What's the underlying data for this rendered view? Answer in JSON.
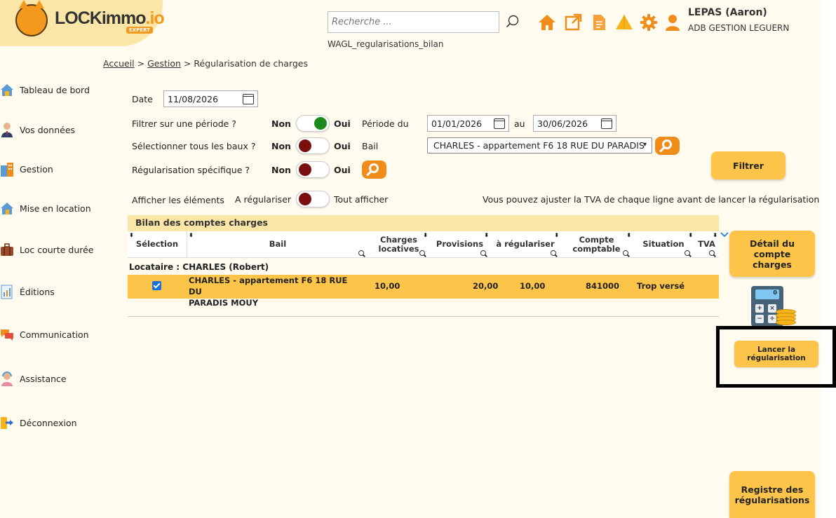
{
  "header": {
    "logo_text": "LOCKimmo",
    "logo_suffix": ".io",
    "logo_badge": "EXPERT",
    "search_placeholder": "Recherche ...",
    "page_code": "WAGL_regularisations_bilan",
    "user_name": "LEPAS (Aaron)",
    "user_org": "ADB GESTION LEGUERN",
    "icons": [
      "home-icon",
      "external-link-icon",
      "document-icon",
      "alert-triangle-icon",
      "gear-icon",
      "user-icon"
    ],
    "accent": "#f08c1a"
  },
  "breadcrumb": {
    "home": "Accueil",
    "sep1": ">",
    "section": "Gestion",
    "sep2": ">",
    "current": "Régularisation de charges"
  },
  "sidebar": {
    "items": [
      {
        "label": "Tableau de bord",
        "icon": "dashboard-house-icon"
      },
      {
        "label": "Vos données",
        "icon": "person-icon"
      },
      {
        "label": "Gestion",
        "icon": "buildings-icon"
      },
      {
        "label": "Mise en location",
        "icon": "house-rent-icon"
      },
      {
        "label": "Loc courte durée",
        "icon": "suitcase-icon"
      },
      {
        "label": "Éditions",
        "icon": "report-icon"
      },
      {
        "label": "Communication",
        "icon": "chat-bubbles-icon"
      },
      {
        "label": "Assistance",
        "icon": "support-agent-icon"
      },
      {
        "label": "Déconnexion",
        "icon": "logout-icon"
      }
    ]
  },
  "form": {
    "date_label": "Date",
    "date_value": "11/08/2026",
    "periode_filter_label": "Filtrer sur une période ?",
    "tous_baux_label": "Sélectionner tous les baux ?",
    "specifique_label": "Régularisation spécifique ?",
    "non": "Non",
    "oui": "Oui",
    "periode_du_label": "Période du",
    "periode_du": "01/01/2026",
    "au_label": "au",
    "periode_au": "30/06/2026",
    "bail_label": "Bail",
    "bail_value": "CHARLES - appartement F6 18 RUE DU PARADIS",
    "afficher_label": "Afficher les éléments",
    "a_regulariser": "A régulariser",
    "tout_afficher": "Tout afficher",
    "tva_note": "Vous pouvez ajuster la TVA de chaque ligne avant de lancer la régularisation",
    "toggles": {
      "periode": "on",
      "tous_baux": "off",
      "specifique": "off",
      "afficher": "off"
    }
  },
  "buttons": {
    "filtrer": "Filtrer",
    "detail_l1": "Détail du",
    "detail_l2": "compte",
    "detail_l3": "charges",
    "lancer_l1": "Lancer la",
    "lancer_l2": "régularisation",
    "registre_l1": "Registre des",
    "registre_l2": "régularisations"
  },
  "table": {
    "title": "Bilan des comptes charges",
    "columns": {
      "selection": "Sélection",
      "bail": "Bail",
      "charges_l1": "Charges",
      "charges_l2": "locatives",
      "provisions": "Provisions",
      "a_regulariser": "à régulariser",
      "compte_l1": "Compte",
      "compte_l2": "comptable",
      "situation": "Situation",
      "tva": "TVA"
    },
    "group": "Locataire : CHARLES (Robert)",
    "rows": [
      {
        "checked": true,
        "bail_l1": "CHARLES - appartement F6 18 RUE DU",
        "bail_l2": "PARADIS MOUY",
        "charges": "10,00",
        "provisions": "20,00",
        "a_regulariser": "10,00",
        "compte": "841000",
        "situation": "Trop versé",
        "tva": ""
      }
    ]
  },
  "calculator": {
    "display": "0",
    "keys": [
      "+",
      "×",
      "−",
      "÷"
    ]
  }
}
